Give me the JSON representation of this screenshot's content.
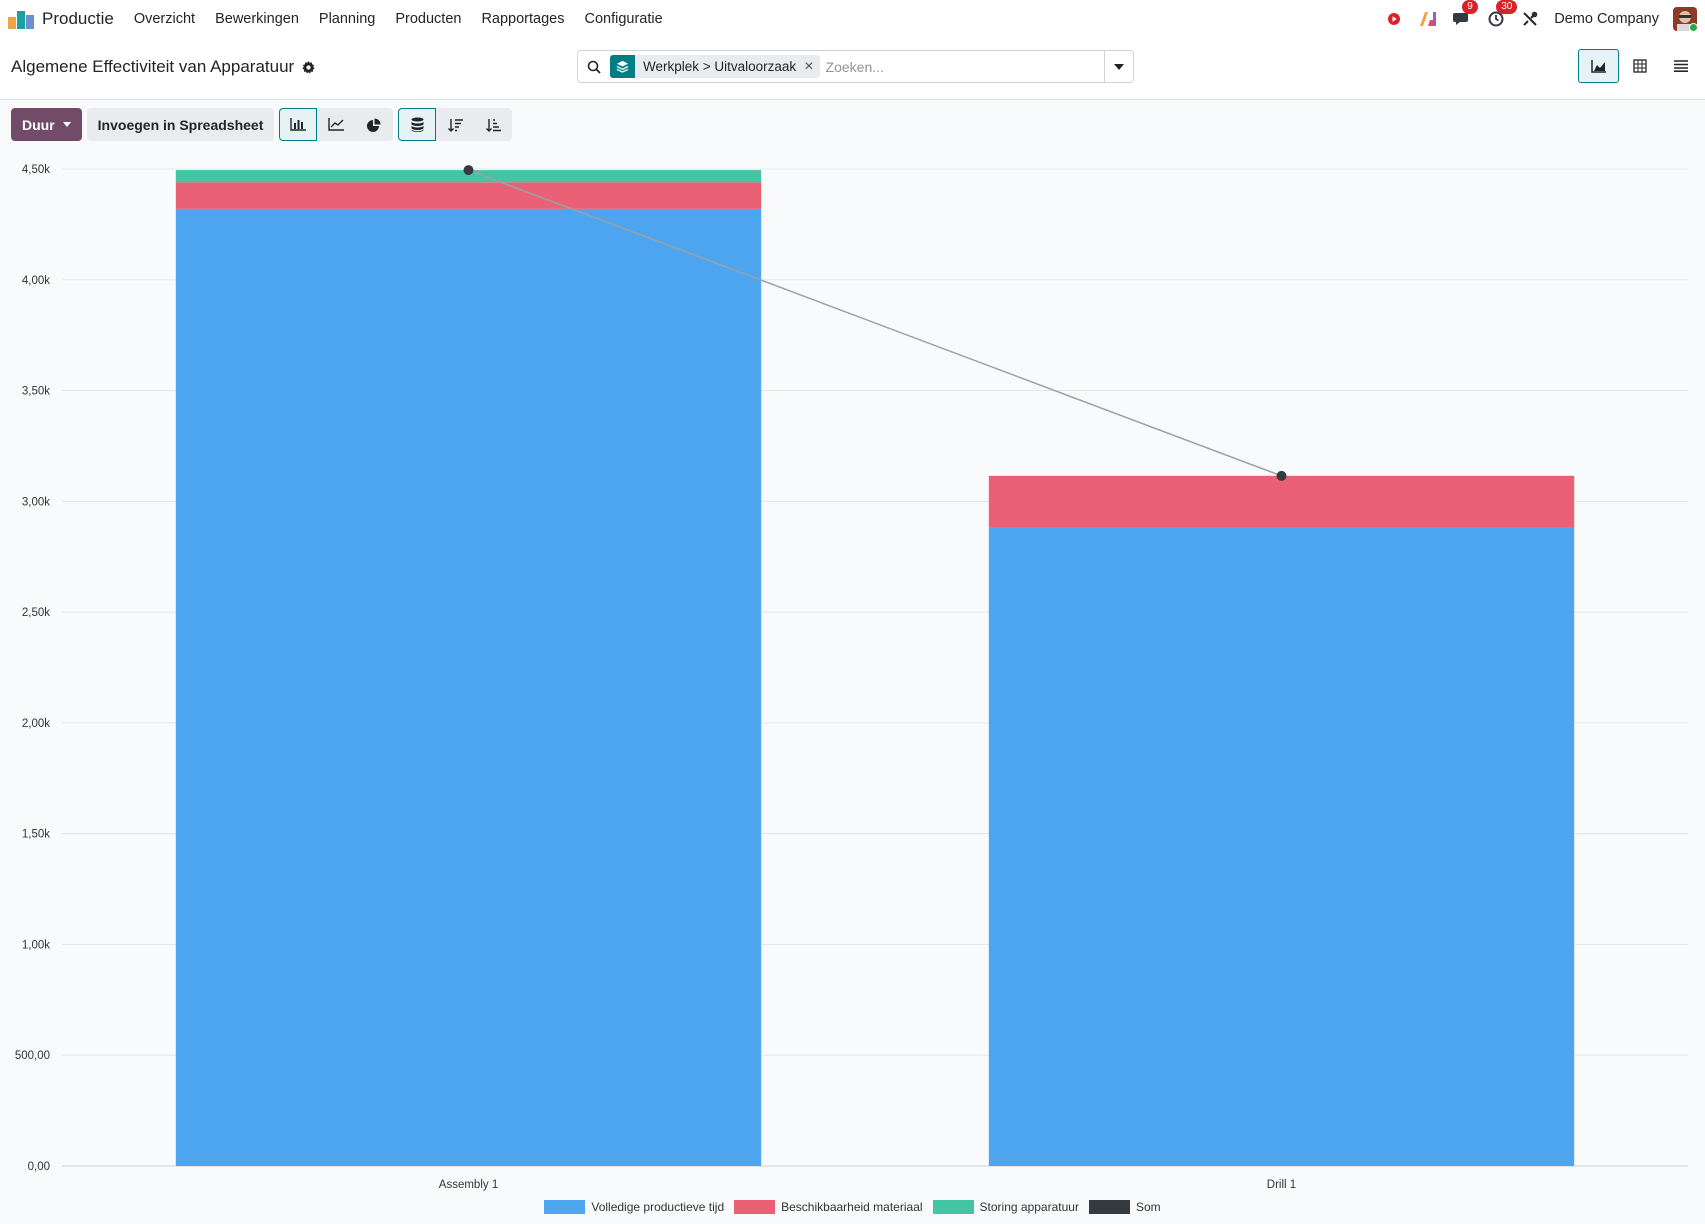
{
  "navbar": {
    "app_name": "Productie",
    "menu": [
      "Overzicht",
      "Bewerkingen",
      "Planning",
      "Producten",
      "Rapportages",
      "Configuratie"
    ],
    "messages_badge": "9",
    "activities_badge": "30",
    "company": "Demo Company"
  },
  "control_panel": {
    "title": "Algemene Effectiviteit van Apparatuur",
    "search": {
      "facet": "Werkplek > Uitvaloorzaak",
      "placeholder": "Zoeken..."
    }
  },
  "toolbar": {
    "measure_label": "Duur",
    "insert_label": "Invoegen in Spreadsheet"
  },
  "colors": {
    "brand": "#714b67",
    "accent": "#017e84"
  },
  "chart_data": {
    "type": "bar",
    "stacked": true,
    "categories": [
      "Assembly 1",
      "Drill 1"
    ],
    "series": [
      {
        "name": "Volledige productieve tijd",
        "values": [
          4320,
          2880
        ],
        "color": "#4fa6f0"
      },
      {
        "name": "Beschikbaarheid materiaal",
        "values": [
          120,
          235
        ],
        "color": "#ea6175"
      },
      {
        "name": "Storing apparatuur",
        "values": [
          55,
          0
        ],
        "color": "#43c5a5"
      }
    ],
    "line_series": {
      "name": "Som",
      "values": [
        4495,
        3115
      ],
      "color": "#343a40"
    },
    "ylim": [
      0,
      4500
    ],
    "yticks": [
      "0,00",
      "500,00",
      "1,00k",
      "1,50k",
      "2,00k",
      "2,50k",
      "3,00k",
      "3,50k",
      "4,00k",
      "4,50k"
    ],
    "grid": true,
    "legend_position": "bottom"
  }
}
